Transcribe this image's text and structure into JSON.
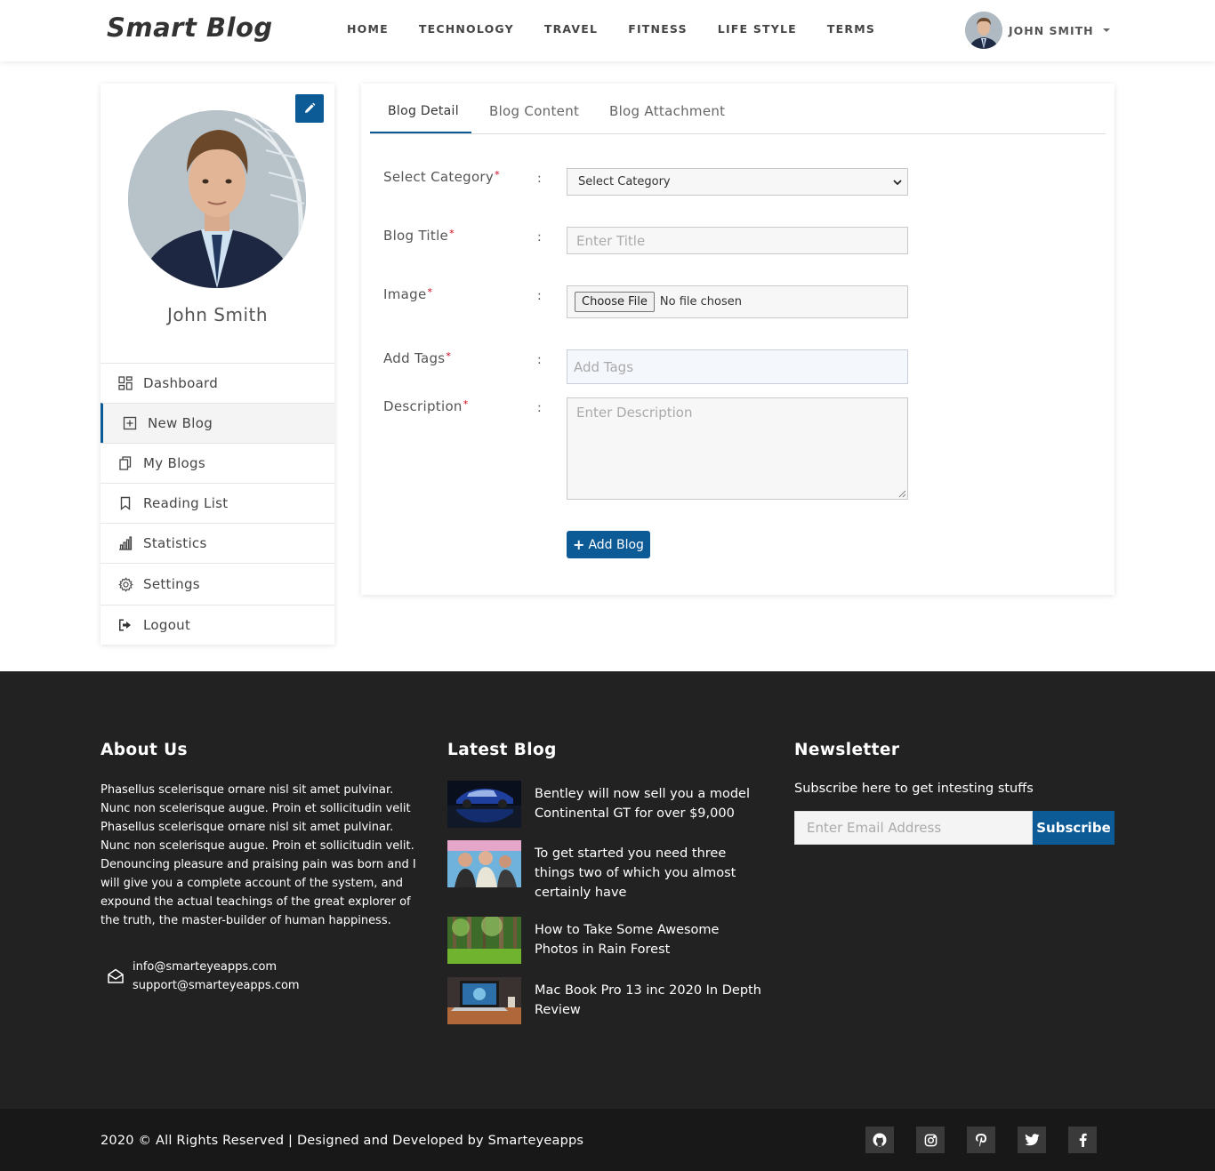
{
  "header": {
    "brand": "Smart Blog",
    "nav": [
      "HOME",
      "TECHNOLOGY",
      "TRAVEL",
      "FITNESS",
      "LIFE STYLE",
      "TERMS"
    ],
    "user_name": "JOHN SMITH"
  },
  "sidebar": {
    "profile_name": "John Smith",
    "items": [
      {
        "label": "Dashboard",
        "icon": "grid-icon"
      },
      {
        "label": "New Blog",
        "icon": "plus-square-icon",
        "active": true
      },
      {
        "label": "My Blogs",
        "icon": "copy-icon"
      },
      {
        "label": "Reading List",
        "icon": "bookmark-icon"
      },
      {
        "label": "Statistics",
        "icon": "bar-chart-icon"
      },
      {
        "label": "Settings",
        "icon": "gear-icon"
      },
      {
        "label": "Logout",
        "icon": "sign-out-icon"
      }
    ]
  },
  "form": {
    "tabs": [
      "Blog Detail",
      "Blog Content",
      "Blog Attachment"
    ],
    "active_tab": "Blog Detail",
    "fields": {
      "category": {
        "label": "Select Category",
        "value": "Select Category"
      },
      "title": {
        "label": "Blog Title",
        "placeholder": "Enter Title"
      },
      "image": {
        "label": "Image",
        "button": "Choose File",
        "status": "No file chosen"
      },
      "tags": {
        "label": "Add Tags",
        "placeholder": "Add Tags"
      },
      "description": {
        "label": "Description",
        "placeholder": "Enter Description"
      }
    },
    "required_mark": "*",
    "colon": ":",
    "submit_label": "Add Blog"
  },
  "footer": {
    "about": {
      "heading": "About Us",
      "text": "Phasellus scelerisque ornare nisl sit amet pulvinar. Nunc non scelerisque augue. Proin et sollicitudin velit Phasellus scelerisque ornare nisl sit amet pulvinar. Nunc non scelerisque augue. Proin et sollicitudin velit. Denouncing pleasure and praising pain was born and I will give you a complete account of the system, and expound the actual teachings of the great explorer of the truth, the master-builder of human happiness.",
      "emails": [
        "info@smarteyeapps.com",
        "support@smarteyeapps.com"
      ]
    },
    "latest": {
      "heading": "Latest Blog",
      "items": [
        "Bentley will now sell you a model Continental GT for over $9,000",
        "To get started you need three things two of which you almost certainly have",
        "How to Take Some Awesome Photos in Rain Forest",
        "Mac Book Pro 13 inc 2020 In Depth Review"
      ]
    },
    "newsletter": {
      "heading": "Newsletter",
      "subtitle": "Subscribe here to get intesting stuffs",
      "placeholder": "Enter Email Address",
      "button": "Subscribe"
    },
    "copyright": "2020 © All Rights Reserved | Designed and Developed by Smarteyeapps",
    "socials": [
      "github-icon",
      "instagram-icon",
      "pinterest-icon",
      "twitter-icon",
      "facebook-icon"
    ]
  },
  "colors": {
    "accent": "#0c5a96",
    "footer_bg": "#222222",
    "bottom_bg": "#181818",
    "required": "#d0021b"
  }
}
